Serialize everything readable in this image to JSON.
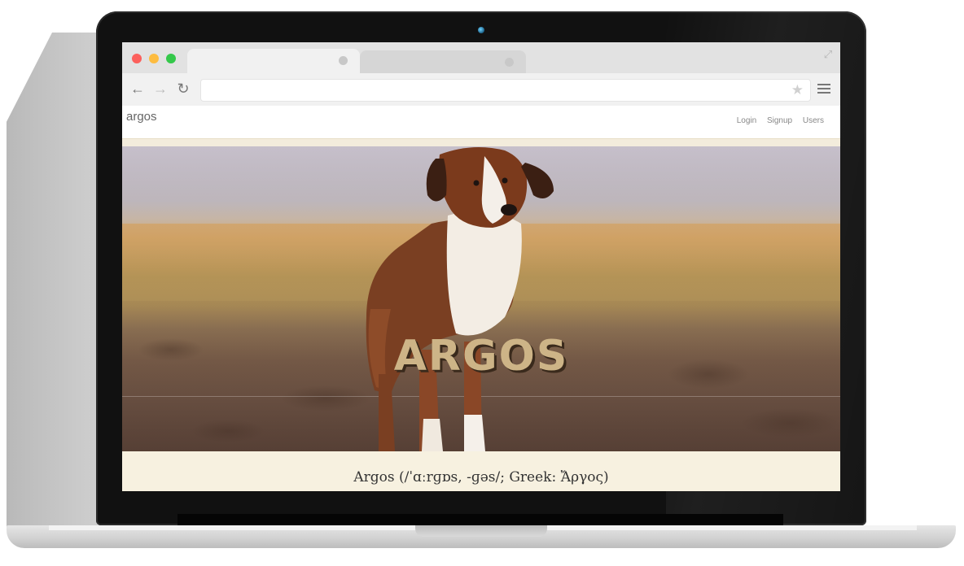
{
  "browser": {
    "window_controls": {
      "close_color": "#fc605c",
      "minimize_color": "#fdbc40",
      "maximize_color": "#34c84a"
    },
    "address_bar": {
      "value": ""
    }
  },
  "site": {
    "brand": "argos",
    "nav": [
      {
        "label": "Login"
      },
      {
        "label": "Signup"
      },
      {
        "label": "Users"
      }
    ],
    "hero": {
      "title": "ARGOS",
      "title_color": "#cdb487"
    },
    "caption": "Argos (/ˈɑːrɡɒs, -ɡəs/; Greek: Ἄργος)"
  }
}
